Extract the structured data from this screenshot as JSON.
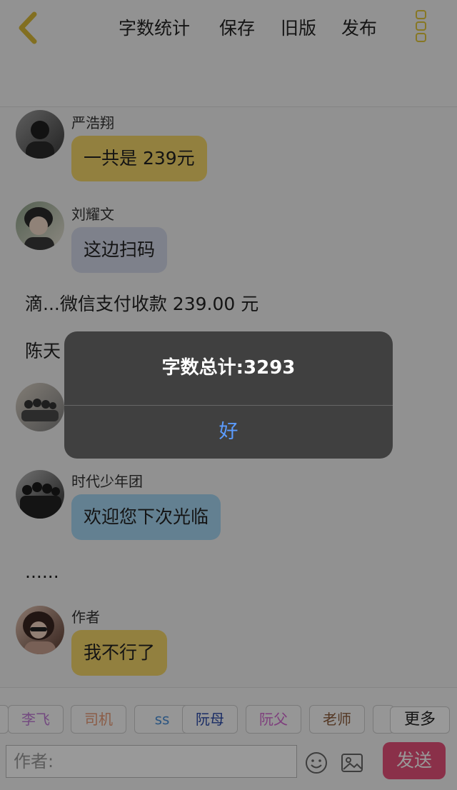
{
  "header": {
    "word_count": "字数统计",
    "save": "保存",
    "old_version": "旧版",
    "publish": "发布"
  },
  "messages": [
    {
      "sender": "严浩翔",
      "text": "一共是 239元",
      "color": "#f4d669"
    },
    {
      "sender": "刘耀文",
      "text": "这边扫码",
      "color": "#d3d8e8"
    },
    {
      "narration": "滴...微信支付收款 239.00 元"
    },
    {
      "narration": "陈天"
    },
    {
      "sender": "时代少年团",
      "text": "欢迎您下次光临",
      "color": "#a6d6f2"
    },
    {
      "narration": "......"
    },
    {
      "sender": "作者",
      "text": "我不行了",
      "color": "#f4d669"
    }
  ],
  "quick_roles": [
    {
      "label": "李飞",
      "color": "#c07bd6"
    },
    {
      "label": "司机",
      "color": "#e89a76"
    },
    {
      "label": "ss",
      "color": "#4a8fd8"
    },
    {
      "label": "阮母",
      "color": "#2b4aa8"
    },
    {
      "label": "阮父",
      "color": "#d36ad0"
    },
    {
      "label": "老师",
      "color": "#8a5a3a"
    }
  ],
  "more_label": "更多",
  "input": {
    "placeholder": "作者:"
  },
  "send_label": "发送",
  "icons": [
    "back-icon",
    "more-icon",
    "emoji-icon",
    "image-icon"
  ],
  "dialog": {
    "message": "字数总计:3293",
    "ok": "好"
  },
  "accent_color": "#e2c63b"
}
